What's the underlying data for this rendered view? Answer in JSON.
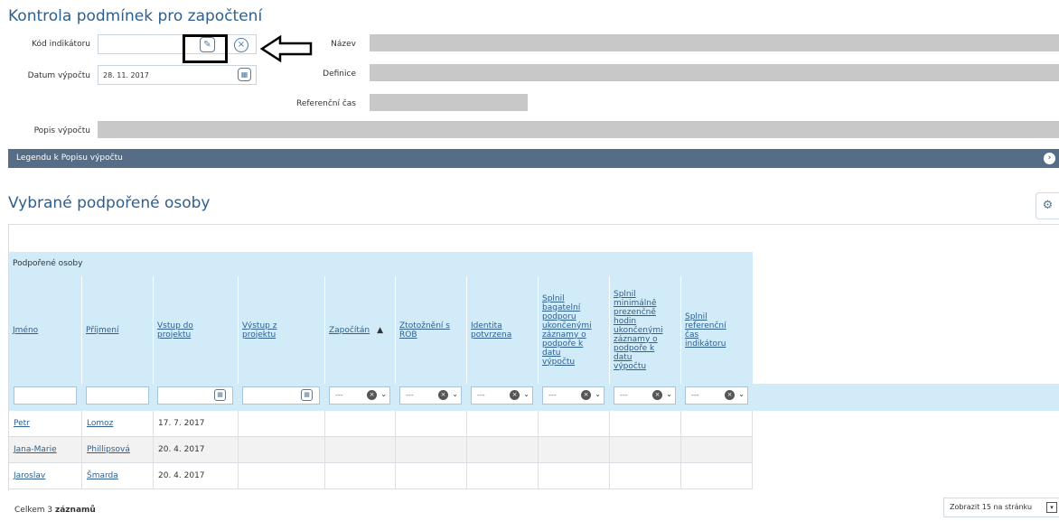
{
  "page_title": "Kontrola podmínek pro započtení",
  "form": {
    "kod_label": "Kód indikátoru",
    "kod_value": "",
    "datum_label": "Datum výpočtu",
    "datum_value": "28. 11. 2017",
    "nazev_label": "Název",
    "definice_label": "Definice",
    "ref_cas_label": "Referenční čas",
    "popis_label": "Popis výpočtu"
  },
  "legend_bar": {
    "label": "Legendu k Popisu výpočtu"
  },
  "section_title": "Vybrané podpořené osoby",
  "grid": {
    "group_header": "Podpořené osoby",
    "columns": [
      "Jméno",
      "Příjmení",
      "Vstup do projektu",
      "Výstup z projektu",
      "Započítán",
      "Ztotožnění s ROB",
      "Identita potvrzena",
      "Splnil bagatelní podporu ukončenými záznamy o podpoře k datu výpočtu",
      "Splnil minimálně prezenčně hodin ukončenými záznamy o podpoře k datu výpočtu",
      "Splnil referenční čas indikátoru"
    ],
    "filter_placeholder": "---",
    "rows": [
      {
        "jmeno": "Petr",
        "prijmeni": "Lomoz",
        "vstup": "17. 7. 2017"
      },
      {
        "jmeno": "Jana-Marie",
        "prijmeni": "Phillipsová",
        "vstup": "20. 4. 2017"
      },
      {
        "jmeno": "Jaroslav",
        "prijmeni": "Šmarda",
        "vstup": "20. 4. 2017"
      }
    ]
  },
  "footer": {
    "count_prefix": "Celkem 3",
    "count_suffix": "záznamů",
    "per_page": "Zobrazit 15 na stránku"
  },
  "icons": {
    "edit": "edit-icon",
    "clear": "clear-icon",
    "calendar": "calendar-icon",
    "gear": "gear-icon",
    "expand": "chevron-right-icon"
  },
  "colors": {
    "title": "#2e5f8e",
    "legend_bar": "#556d87",
    "grid_header": "#d2ebf9",
    "readonly_field": "#c8c8c8"
  }
}
